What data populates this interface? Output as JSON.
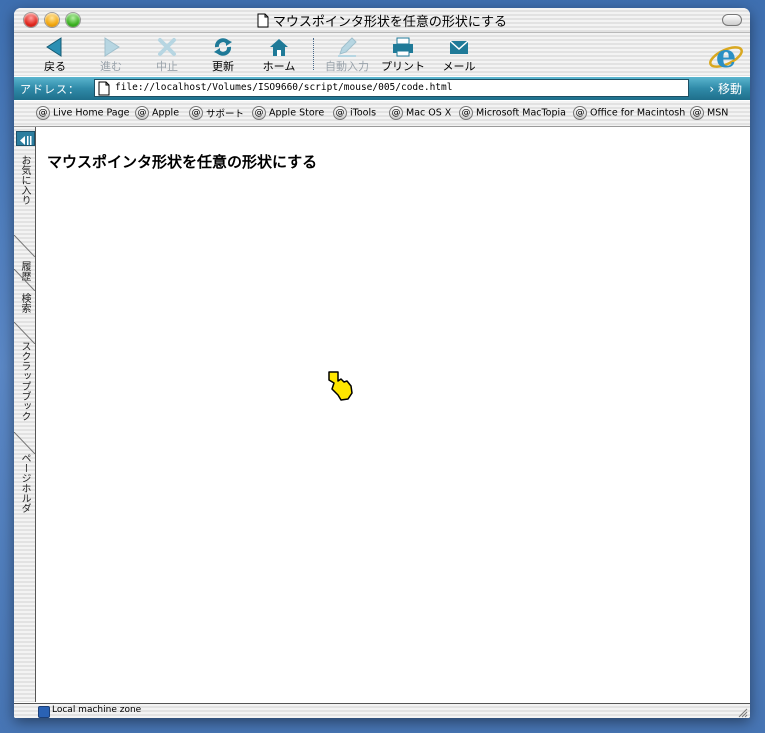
{
  "window": {
    "title": "マウスポインタ形状を任意の形状にする"
  },
  "toolbar": {
    "buttons": [
      {
        "label": "戻る",
        "icon": "back-arrow-icon",
        "enabled": true
      },
      {
        "label": "進む",
        "icon": "forward-arrow-icon",
        "enabled": false
      },
      {
        "label": "中止",
        "icon": "stop-icon",
        "enabled": false
      },
      {
        "label": "更新",
        "icon": "refresh-icon",
        "enabled": true
      },
      {
        "label": "ホーム",
        "icon": "home-icon",
        "enabled": true
      },
      {
        "label": "自動入力",
        "icon": "autofill-icon",
        "enabled": false
      },
      {
        "label": "プリント",
        "icon": "print-icon",
        "enabled": true
      },
      {
        "label": "メール",
        "icon": "mail-icon",
        "enabled": true
      }
    ]
  },
  "address": {
    "label": "アドレス：",
    "url": "file://localhost/Volumes/ISO9660/script/mouse/005/code.html",
    "go_label": "移動"
  },
  "favorites": [
    "Live Home Page",
    "Apple",
    "サポート",
    "Apple Store",
    "iTools",
    "Mac OS X",
    "Microsoft MacTopia",
    "Office for Macintosh",
    "MSN"
  ],
  "sidebar": {
    "tabs": [
      "お気に入り",
      "履歴",
      "検索",
      "スクラップブック",
      "ページホルダ"
    ]
  },
  "page": {
    "heading": "マウスポインタ形状を任意の形状にする"
  },
  "status": {
    "zone": "Local machine zone"
  },
  "colors": {
    "accent": "#2f8aa8",
    "cursor_fill": "#ffe600"
  }
}
